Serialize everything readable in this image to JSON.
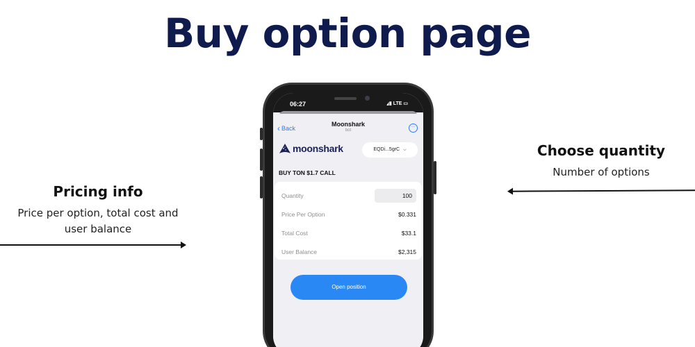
{
  "page": {
    "title": "Buy option page"
  },
  "annotations": {
    "left": {
      "title": "Pricing info",
      "subtitle": "Price per option, total cost and user balance"
    },
    "right": {
      "title": "Choose quantity",
      "subtitle": "Number of options"
    }
  },
  "phone": {
    "status_time": "06:27",
    "status_network": "LTE",
    "nav": {
      "back_label": "Back",
      "title": "Moonshark",
      "subtitle": "bot"
    },
    "brand_name": "moonshark",
    "wallet_label": "EQDi...5grC",
    "heading": "BUY TON $1.7 CALL",
    "rows": [
      {
        "label": "Quantity",
        "value": "100"
      },
      {
        "label": "Price Per Option",
        "value": "$0.331"
      },
      {
        "label": "Total Cost",
        "value": "$33.1"
      },
      {
        "label": "User Balance",
        "value": "$2,315"
      }
    ],
    "open_button_label": "Open position"
  },
  "colors": {
    "title": "#0f1a4d",
    "accent": "#2a88f5",
    "brand": "#1a2254"
  },
  "icons": [
    "chevron-left-icon",
    "more-icon",
    "moonshark-logo-icon",
    "chevron-down-icon"
  ]
}
